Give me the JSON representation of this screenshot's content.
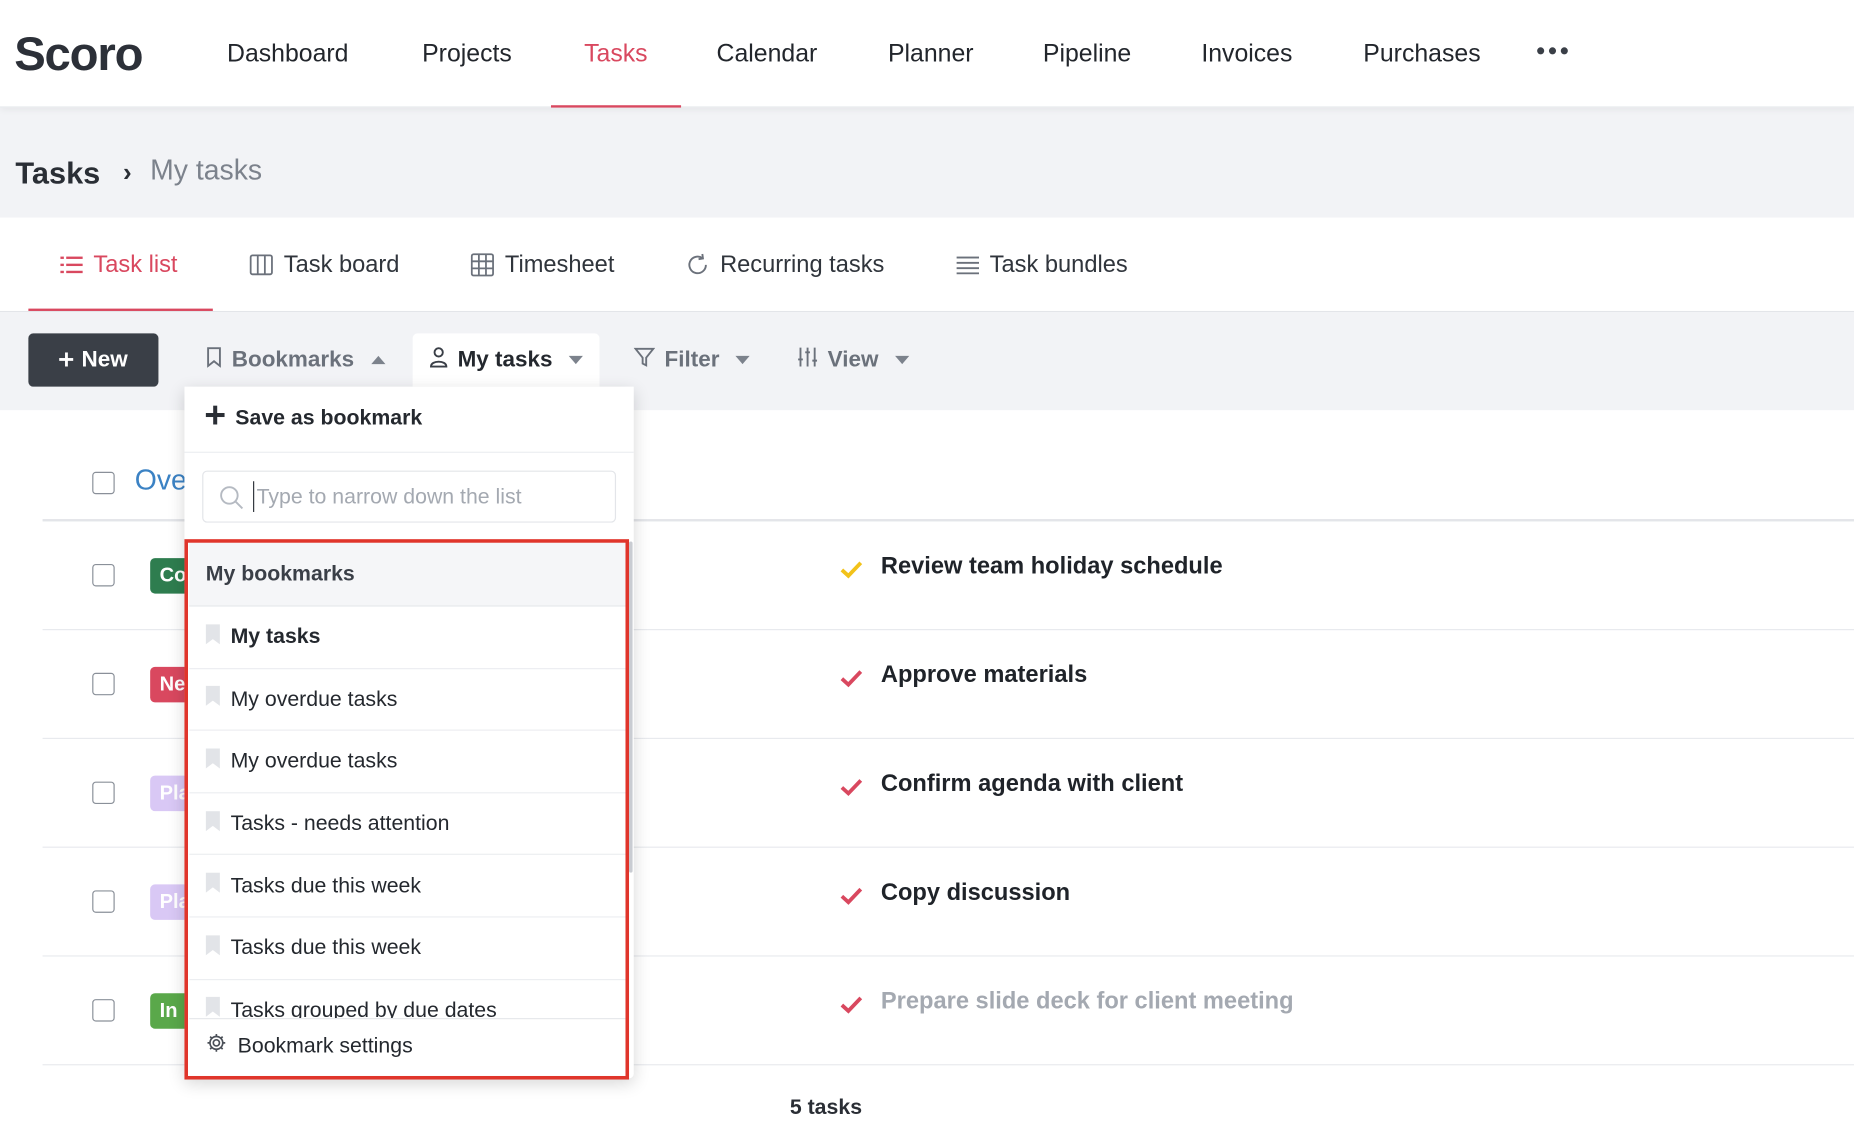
{
  "app": {
    "logo_text": "Scoro",
    "accent_color": "#d9485f"
  },
  "nav": {
    "items": [
      {
        "label": "Dashboard"
      },
      {
        "label": "Projects"
      },
      {
        "label": "Tasks",
        "active": true
      },
      {
        "label": "Calendar"
      },
      {
        "label": "Planner"
      },
      {
        "label": "Pipeline"
      },
      {
        "label": "Invoices"
      },
      {
        "label": "Purchases"
      }
    ],
    "more_icon": "more-dots-icon"
  },
  "breadcrumb": {
    "root": "Tasks",
    "separator": "›",
    "current": "My tasks"
  },
  "subtabs": [
    {
      "label": "Task list",
      "icon": "list-icon",
      "active": true
    },
    {
      "label": "Task board",
      "icon": "board-columns-icon"
    },
    {
      "label": "Timesheet",
      "icon": "grid-table-icon"
    },
    {
      "label": "Recurring tasks",
      "icon": "refresh-icon"
    },
    {
      "label": "Task bundles",
      "icon": "lines-icon"
    }
  ],
  "toolbar": {
    "new_label": "New",
    "bookmarks_label": "Bookmarks",
    "mytasks_label": "My tasks",
    "filter_label": "Filter",
    "view_label": "View"
  },
  "group": {
    "title": "Ove"
  },
  "rows": [
    {
      "badge": "Co",
      "badge_color": "#2e7d4f",
      "check_color": "#f2c21a",
      "title": "Review team holiday schedule",
      "muted": false
    },
    {
      "badge": "Ne",
      "badge_color": "#d9485f",
      "check_color": "#d9485f",
      "title": "Approve materials",
      "muted": false
    },
    {
      "badge": "Pla",
      "badge_color": "#d9c8f5",
      "check_color": "#d9485f",
      "title": "Confirm agenda with client",
      "muted": false
    },
    {
      "badge": "Pla",
      "badge_color": "#d9c8f5",
      "check_color": "#d9485f",
      "title": "Copy discussion",
      "muted": false
    },
    {
      "badge": "In",
      "badge_color": "#5aa84a",
      "check_color": "#d9485f",
      "title": "Prepare slide deck for client meeting",
      "muted": true
    }
  ],
  "footer": {
    "count_label": "5 tasks"
  },
  "dropdown": {
    "save_label": "Save as bookmark",
    "search_placeholder": "Type to narrow down the list",
    "section_title": "My bookmarks",
    "items": [
      {
        "label": "My tasks",
        "bold": true
      },
      {
        "label": "My overdue tasks"
      },
      {
        "label": "My overdue tasks"
      },
      {
        "label": "Tasks - needs attention"
      },
      {
        "label": "Tasks due this week"
      },
      {
        "label": "Tasks due this week"
      },
      {
        "label": "Tasks grouped by due dates"
      }
    ],
    "settings_label": "Bookmark settings"
  }
}
